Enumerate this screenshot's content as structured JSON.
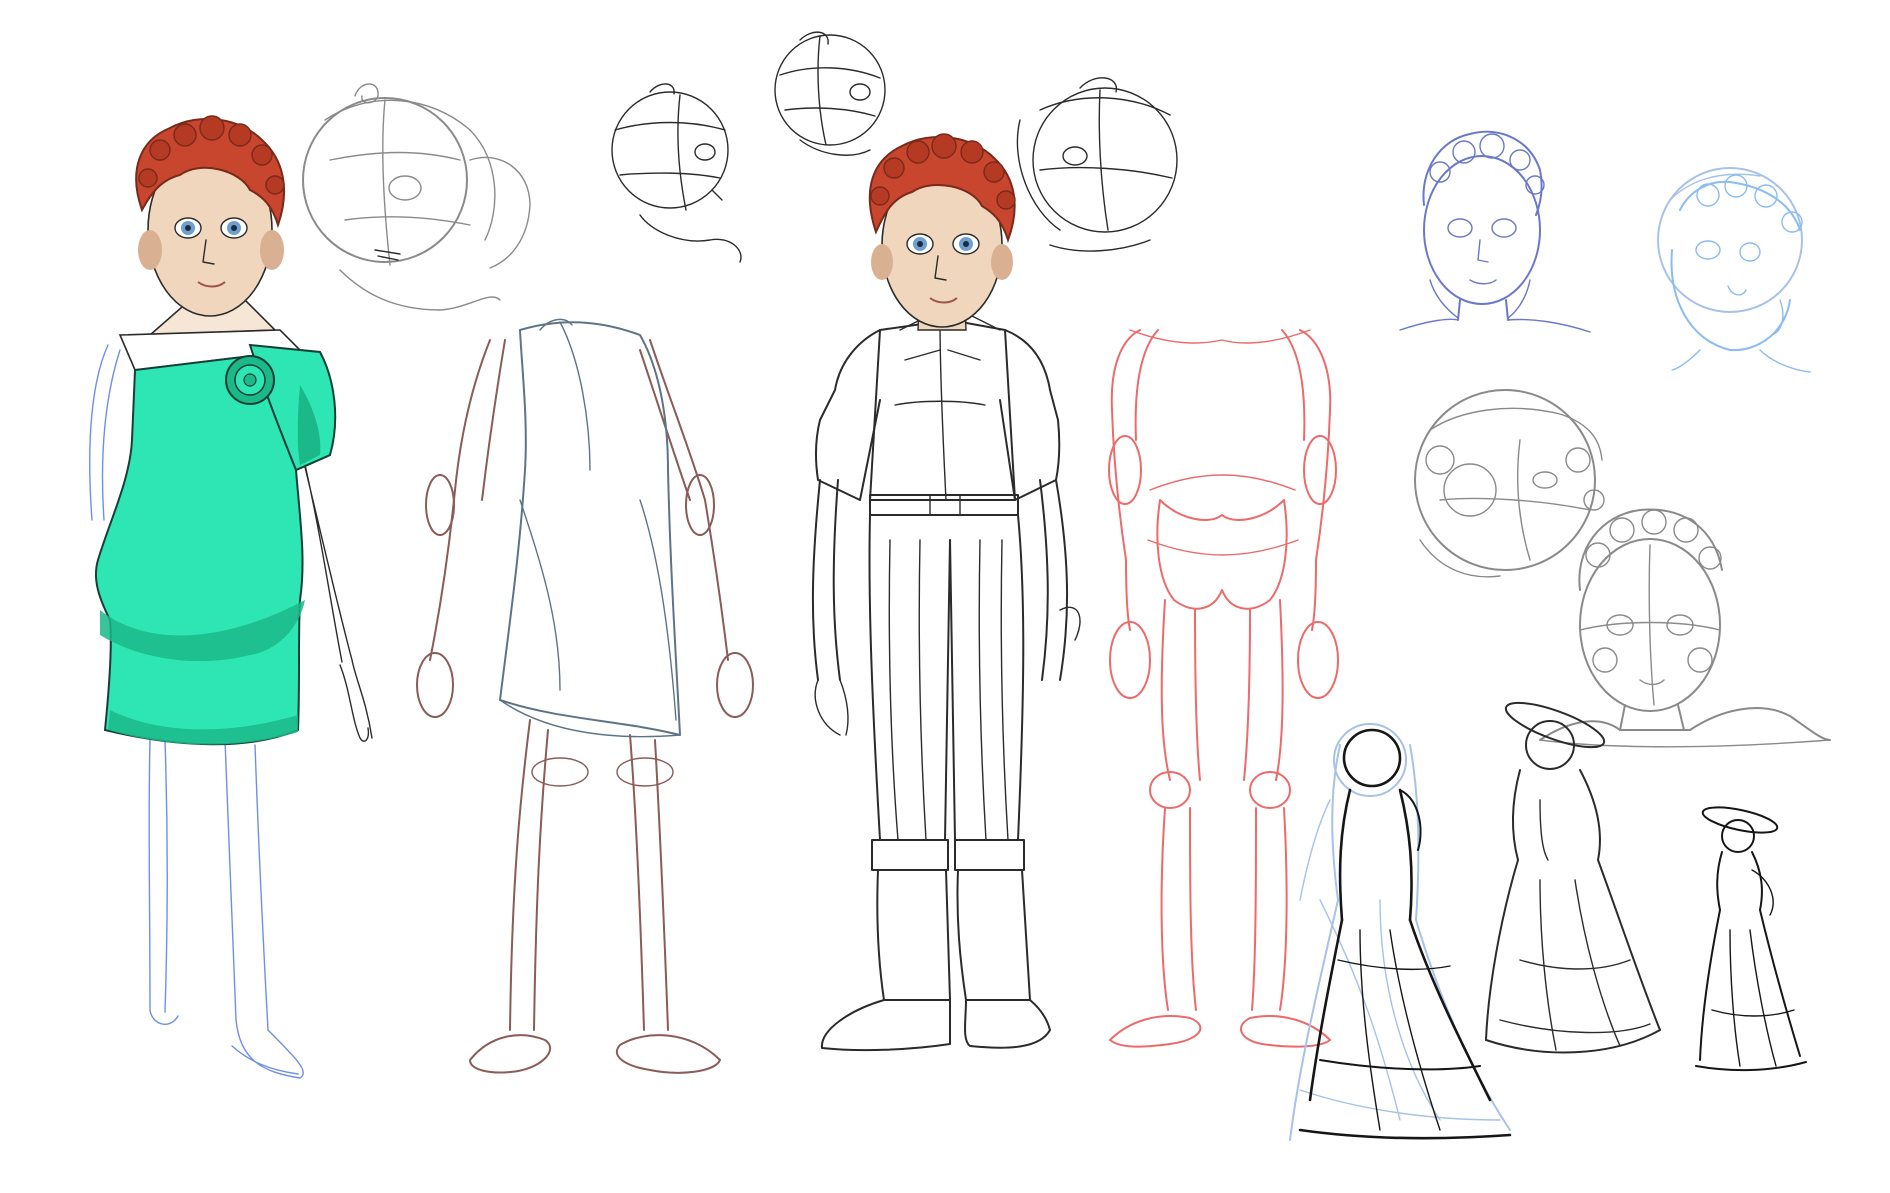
{
  "canvas": {
    "background": "#ffffff"
  },
  "palette": {
    "dress_teal": "#2ee6b4",
    "dress_teal_shadow": "#1bb889",
    "hair_auburn": "#c9462e",
    "hair_dark": "#7a2a1a",
    "skin": "#f1d6be",
    "skin_shadow": "#d9b092",
    "eye_blue": "#6d9fd0",
    "sketch_grey": "#8a8a8a",
    "sketch_dark": "#2b2b2b",
    "sketch_brown": "#8a5b57",
    "sketch_slate": "#5e7486",
    "sketch_red": "#ec6a6a",
    "sketch_blue": "#6f8ee8",
    "sketch_navy": "#6a78c8",
    "sketch_sky": "#8bbcf0"
  },
  "figures": [
    {
      "id": "colored-figure-teal-dress",
      "rendering": "colored-lineart"
    },
    {
      "id": "dress-construction-sketch",
      "rendering": "brown-slate-sketch"
    },
    {
      "id": "explorer-outfit-lineart",
      "rendering": "lineart-with-colored-head"
    },
    {
      "id": "red-mannequin-sketch",
      "rendering": "red-sketch"
    },
    {
      "id": "victorian-gown-sketches",
      "rendering": "black-blue-sketch"
    }
  ],
  "head_studies": [
    {
      "id": "head-sketch-turned-left",
      "rendering": "grey-sketch"
    },
    {
      "id": "head-sketch-small-a",
      "rendering": "dark-sketch"
    },
    {
      "id": "head-sketch-small-b",
      "rendering": "dark-sketch"
    },
    {
      "id": "head-sketch-right-turn",
      "rendering": "dark-sketch"
    },
    {
      "id": "head-sketch-navy-front",
      "rendering": "navy-lineart"
    },
    {
      "id": "head-sketch-sky-three-quarter",
      "rendering": "blue-lineart"
    },
    {
      "id": "head-sketch-grey-tilted",
      "rendering": "grey-sketch"
    },
    {
      "id": "bust-sketch-grey-front",
      "rendering": "grey-sketch"
    }
  ]
}
